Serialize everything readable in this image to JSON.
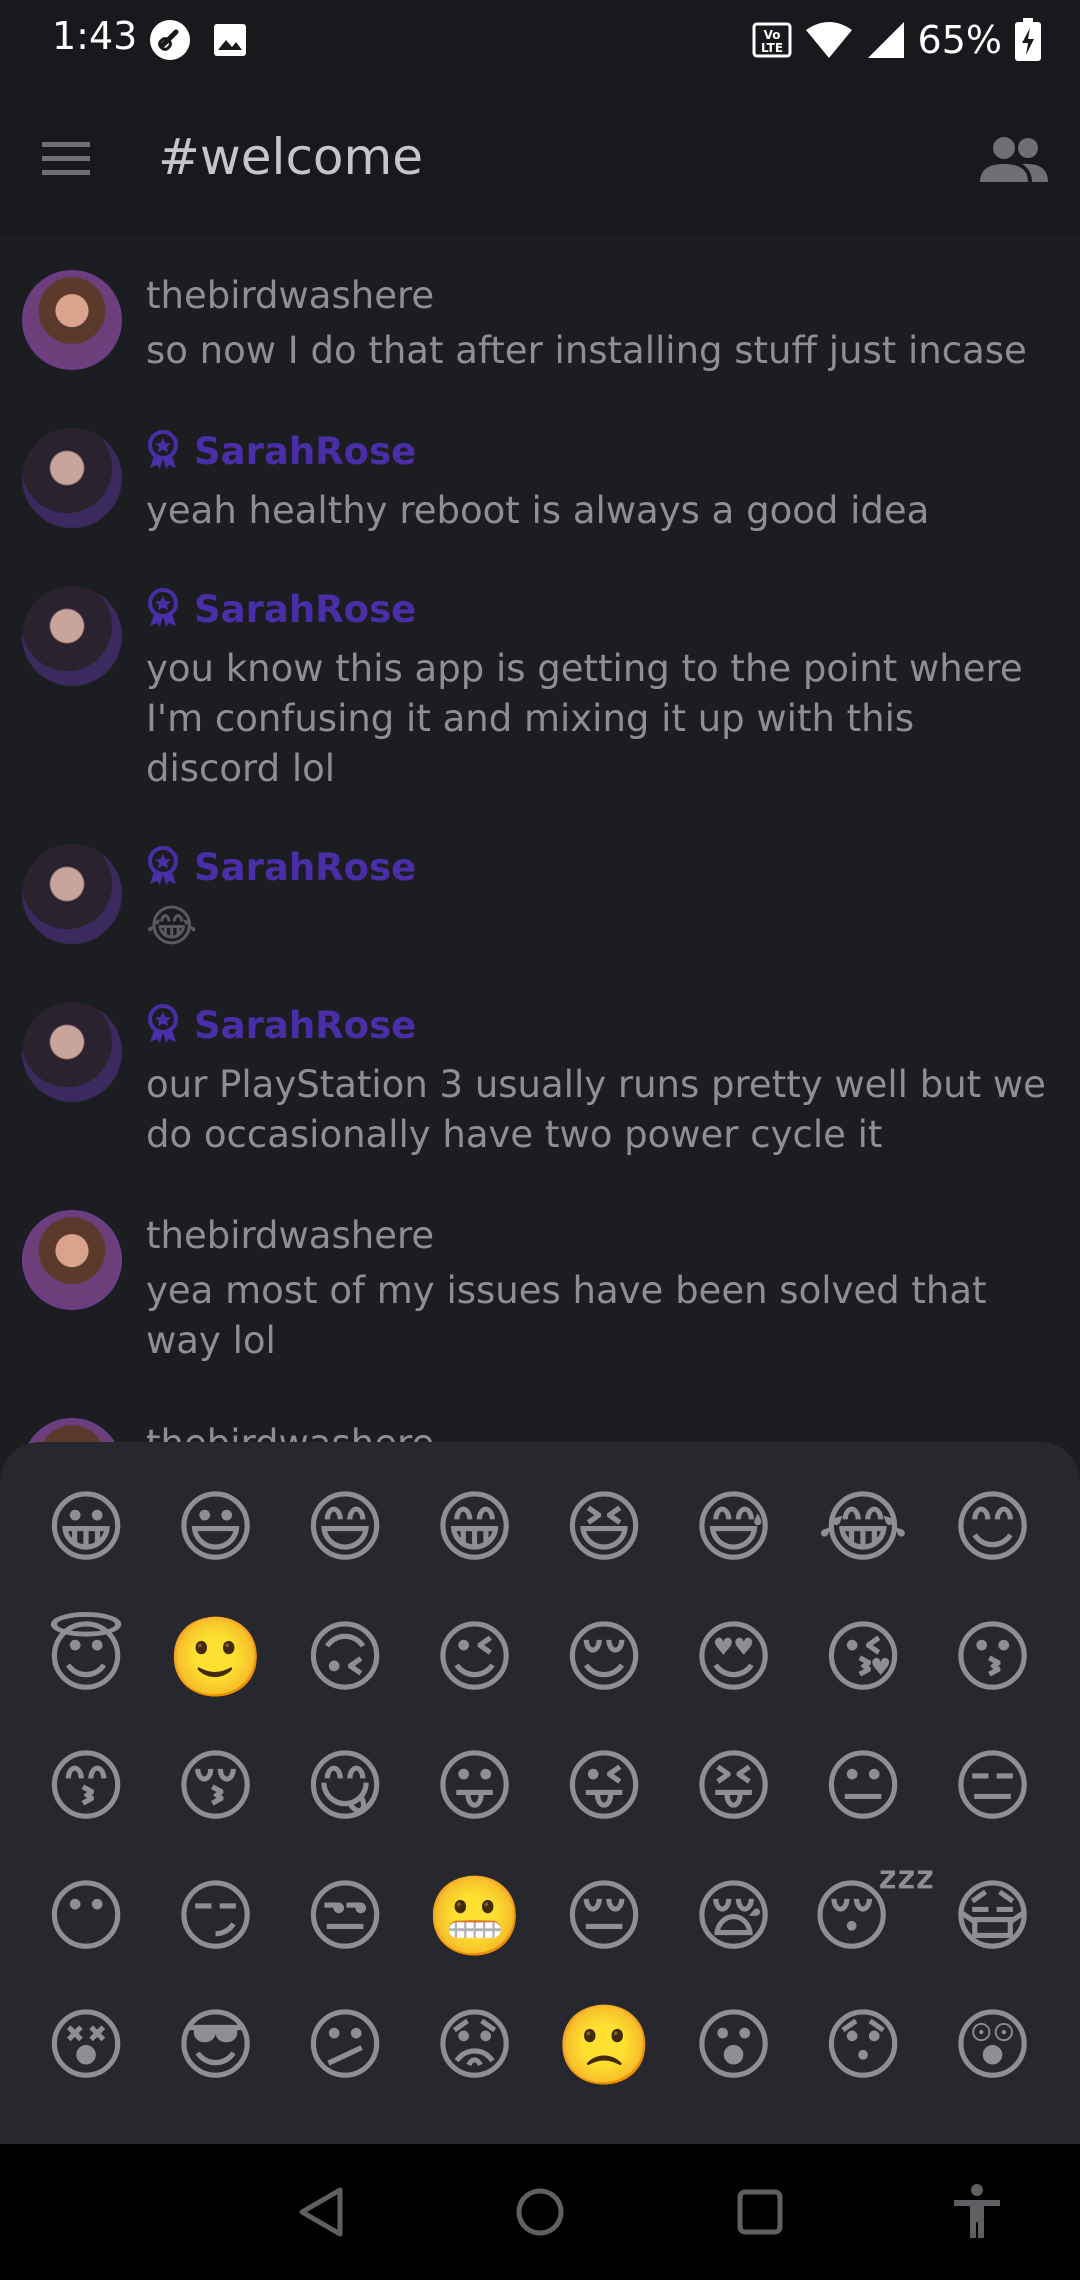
{
  "status_bar": {
    "time": "1:43",
    "battery": "65%",
    "network_label": "VoLTE"
  },
  "channel": {
    "title": "#welcome"
  },
  "messages": [
    {
      "author": "thebirdwashere",
      "role": "member",
      "text": "so now I do that after installing stuff just incase"
    },
    {
      "author": "SarahRose",
      "role": "moderator",
      "text": "yeah healthy reboot is always a good idea"
    },
    {
      "author": "SarahRose",
      "role": "moderator",
      "text": "you know this app is getting to the point where I'm confusing it and mixing it up with this discord lol"
    },
    {
      "author": "SarahRose",
      "role": "moderator",
      "text": "😂"
    },
    {
      "author": "SarahRose",
      "role": "moderator",
      "text": "our PlayStation 3 usually runs pretty well but we do occasionally have two power cycle it"
    },
    {
      "author": "thebirdwashere",
      "role": "member",
      "text": "yea most of my issues have been solved that way lol"
    },
    {
      "author": "thebirdwashere",
      "role": "member",
      "text": ""
    }
  ],
  "emoji_picker": {
    "rows": [
      [
        "😀",
        "😃",
        "😄",
        "😁",
        "😆",
        "😅",
        "😂",
        "😊"
      ],
      [
        "😇",
        "🙂",
        "🙃",
        "😉",
        "😌",
        "😍",
        "😘",
        "😗"
      ],
      [
        "😙",
        "😚",
        "😋",
        "😛",
        "😜",
        "😝",
        "😐",
        "😑"
      ],
      [
        "😶",
        "😏",
        "😒",
        "😬",
        "😔",
        "😪",
        "😴",
        "😷"
      ],
      [
        "😵",
        "😎",
        "😕",
        "😟",
        "🙁",
        "😮",
        "😯",
        "😲"
      ]
    ]
  },
  "colors": {
    "background": "#1c1d21",
    "header": "#18191c",
    "moderator_name": "#4a2ea8",
    "text": "#8e8f94",
    "picker": "#27282d"
  }
}
